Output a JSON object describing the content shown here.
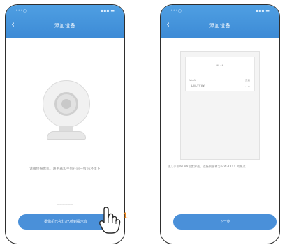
{
  "colors": {
    "header": "#4a9be0",
    "button": "#4a90d9",
    "step_marker": "#f08a1f"
  },
  "screen1": {
    "status_left": "•••○",
    "status_right": "▪▪▪ ▬",
    "title": "添加设备",
    "hint": "请确保摄像机、路由器和手机在同一WiFi环境下",
    "subhint": "——————",
    "button_label": "摄像机已亮灯/已听到提示音",
    "step_number": "1"
  },
  "screen2": {
    "status_left": "•••○",
    "status_right": "▪▪▪ ▬",
    "title": "添加设备",
    "mock": {
      "title": "WLAN",
      "label_left": "WLAN",
      "label_right": "开启",
      "device_name": "HW-XXXX",
      "device_icons": "◦ ≈"
    },
    "hint": "进入手机WLAN设置界面，连接到名称为 HW-XXXX 的热点",
    "button_label": "下一步"
  }
}
